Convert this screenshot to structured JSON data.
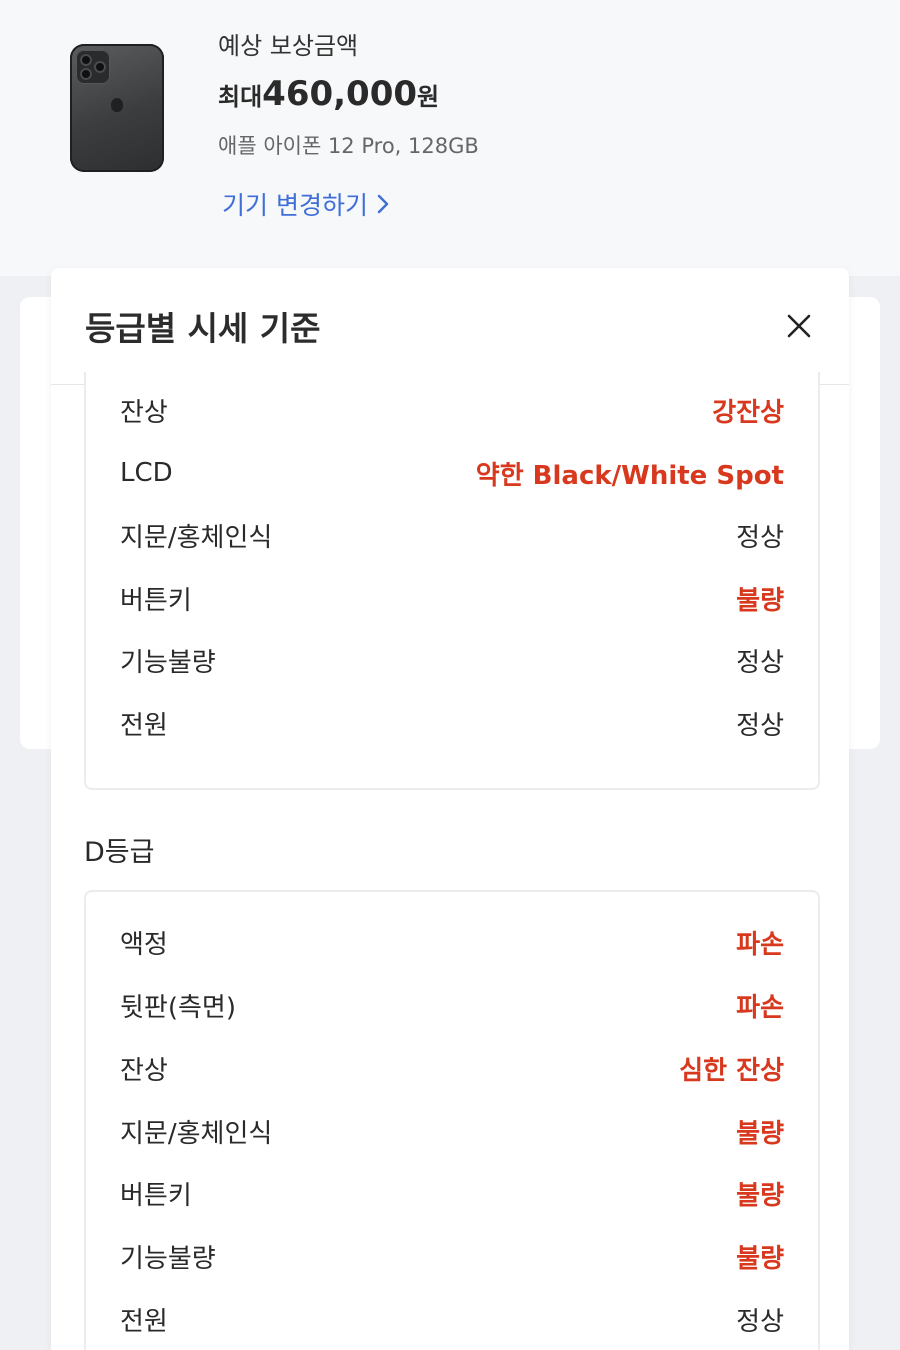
{
  "header": {
    "estimate_label": "예상 보상금액",
    "price_prefix": "최대",
    "price_amount": "460,000",
    "price_unit": "원",
    "model_name": "애플 아이폰 12 Pro, 128GB",
    "change_device_label": "기기 변경하기",
    "link_color": "#3f6ed8"
  },
  "modal": {
    "title": "등급별 시세 기준",
    "close_icon": "close-icon",
    "sections": [
      {
        "name": "",
        "rows": [
          {
            "label": "잔상",
            "value": "강잔상",
            "status": "bad"
          },
          {
            "label": "LCD",
            "value": "약한 Black/White Spot",
            "status": "bad"
          },
          {
            "label": "지문/홍체인식",
            "value": "정상",
            "status": "normal"
          },
          {
            "label": "버튼키",
            "value": "불량",
            "status": "bad"
          },
          {
            "label": "기능불량",
            "value": "정상",
            "status": "normal"
          },
          {
            "label": "전원",
            "value": "정상",
            "status": "normal"
          }
        ]
      },
      {
        "name": "D등급",
        "rows": [
          {
            "label": "액정",
            "value": "파손",
            "status": "bad"
          },
          {
            "label": "뒷판(측면)",
            "value": "파손",
            "status": "bad"
          },
          {
            "label": "잔상",
            "value": "심한 잔상",
            "status": "bad"
          },
          {
            "label": "지문/홍체인식",
            "value": "불량",
            "status": "bad"
          },
          {
            "label": "버튼키",
            "value": "불량",
            "status": "bad"
          },
          {
            "label": "기능불량",
            "value": "불량",
            "status": "bad"
          },
          {
            "label": "전원",
            "value": "정상",
            "status": "normal"
          }
        ]
      }
    ],
    "bad_color": "#d8391e"
  }
}
